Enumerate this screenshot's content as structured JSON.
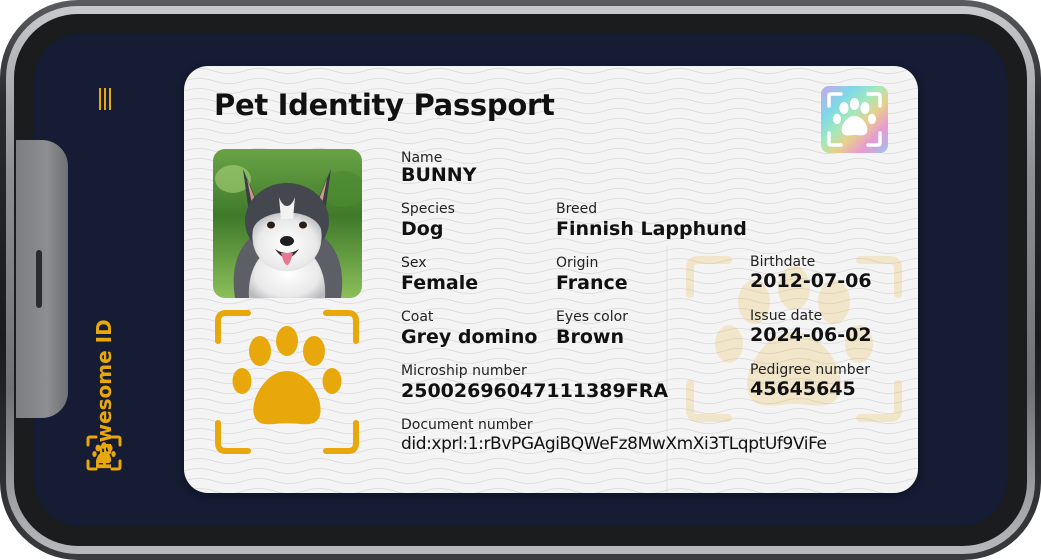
{
  "app": {
    "brand_name": "Pawesome ID",
    "accent_color": "#e8a80c",
    "screen_color": "#151c33"
  },
  "sidebar": {
    "menu_icon": "menu-icon",
    "logo_icon": "paw-icon"
  },
  "card": {
    "title": "Pet Identity Passport",
    "hologram_icon": "paw-hologram-icon",
    "photo": "dog-photo",
    "fields": {
      "name": {
        "label": "Name",
        "value": "BUNNY"
      },
      "species": {
        "label": "Species",
        "value": "Dog"
      },
      "breed": {
        "label": "Breed",
        "value": "Finnish Lapphund"
      },
      "sex": {
        "label": "Sex",
        "value": "Female"
      },
      "origin": {
        "label": "Origin",
        "value": "France"
      },
      "coat": {
        "label": "Coat",
        "value": "Grey domino"
      },
      "eyes": {
        "label": "Eyes color",
        "value": "Brown"
      },
      "microchip": {
        "label": "Microship number",
        "value": "25002696047111389FRA"
      },
      "document": {
        "label": "Document number",
        "value": "did:xprl:1:rBvPGAgiBQWeFz8MwXmXi3TLqptUf9ViFe"
      },
      "birthdate": {
        "label": "Birthdate",
        "value": "2012-07-06"
      },
      "issue": {
        "label": "Issue date",
        "value": "2024-06-02"
      },
      "pedigree": {
        "label": "Pedigree number",
        "value": "45645645"
      }
    }
  }
}
